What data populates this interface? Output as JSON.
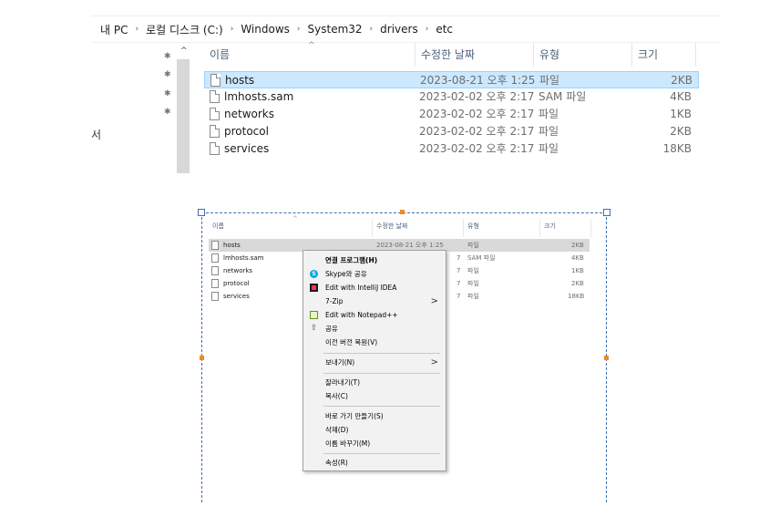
{
  "breadcrumb": [
    "내 PC",
    "로컬 디스크 (C:)",
    "Windows",
    "System32",
    "drivers",
    "etc"
  ],
  "nav": {
    "partial_text": "서"
  },
  "columns": {
    "name": "이름",
    "modified": "수정한 날짜",
    "type": "유형",
    "size": "크기"
  },
  "files": [
    {
      "name": "hosts",
      "modified": "2023-08-21 오후 1:25",
      "type": "파일",
      "size": "2KB",
      "selected": true
    },
    {
      "name": "lmhosts.sam",
      "modified": "2023-02-02 오후 2:17",
      "type": "SAM 파일",
      "size": "4KB",
      "selected": false
    },
    {
      "name": "networks",
      "modified": "2023-02-02 오후 2:17",
      "type": "파일",
      "size": "1KB",
      "selected": false
    },
    {
      "name": "protocol",
      "modified": "2023-02-02 오후 2:17",
      "type": "파일",
      "size": "2KB",
      "selected": false
    },
    {
      "name": "services",
      "modified": "2023-02-02 오후 2:17",
      "type": "파일",
      "size": "18KB",
      "selected": false
    }
  ],
  "capture": {
    "hosts_modified": "2023-08-21 오후 1:25",
    "partial_modified": "7",
    "context_menu": {
      "open_with": "연결 프로그램(H)",
      "skype_share": "Skype와 공유",
      "intellij": "Edit with IntelliJ IDEA",
      "zip": "7-Zip",
      "notepad": "Edit with Notepad++",
      "share": "공유",
      "restore": "이전 버전 복원(V)",
      "send_to": "보내기(N)",
      "cut": "잘라내기(T)",
      "copy": "복사(C)",
      "shortcut": "바로 가기 만들기(S)",
      "delete": "삭제(D)",
      "rename": "이름 바꾸기(M)",
      "properties": "속성(R)",
      "submenu_arrow": ">"
    }
  },
  "icons": {
    "pin": "✱",
    "collapse": "^",
    "sort_up": "^",
    "crumb_sep": "›",
    "share": "⇪",
    "skype": "S"
  },
  "colors": {
    "selected_row": "#cce8ff",
    "selection_frame": "#3b6fb6",
    "handle": "#f08a24"
  }
}
